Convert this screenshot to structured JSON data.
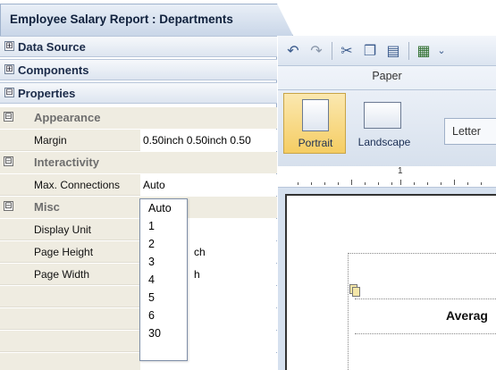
{
  "window": {
    "title": "Employee Salary Report : Departments"
  },
  "sections": [
    {
      "label": "Data Source",
      "expander": "⊞"
    },
    {
      "label": "Components",
      "expander": "⊞"
    },
    {
      "label": "Properties",
      "expander": "⊟"
    }
  ],
  "groups": {
    "appearance": {
      "label": "Appearance",
      "expander": "⊟"
    },
    "interactivity": {
      "label": "Interactivity",
      "expander": "⊟"
    },
    "misc": {
      "label": "Misc",
      "expander": "⊟"
    }
  },
  "properties": {
    "margin": {
      "name": "Margin",
      "value": "0.50inch 0.50inch 0.50"
    },
    "max_connections": {
      "name": "Max. Connections",
      "value": "Auto"
    },
    "display_unit": {
      "name": "Display Unit",
      "value": ""
    },
    "page_height": {
      "name": "Page Height",
      "value": "ch"
    },
    "page_width": {
      "name": "Page Width",
      "value": "h"
    }
  },
  "dropdown": {
    "options": [
      "Auto",
      "1",
      "2",
      "3",
      "4",
      "5",
      "6",
      "30"
    ]
  },
  "toolbar": {
    "icons": [
      "undo-icon",
      "redo-icon",
      "cut-icon",
      "copy-icon",
      "paste-icon",
      "insert-icon",
      "dropdown-arrow-icon"
    ]
  },
  "ribbon": {
    "group_label": "Paper",
    "portrait_label": "Portrait",
    "landscape_label": "Landscape",
    "paper_size": "Letter"
  },
  "ruler": {
    "mark": "1"
  },
  "canvas": {
    "cell_text": "Averag"
  },
  "colors": {
    "accent": "#f5cd63",
    "panel": "#efece1",
    "header": "#dde5f0"
  }
}
